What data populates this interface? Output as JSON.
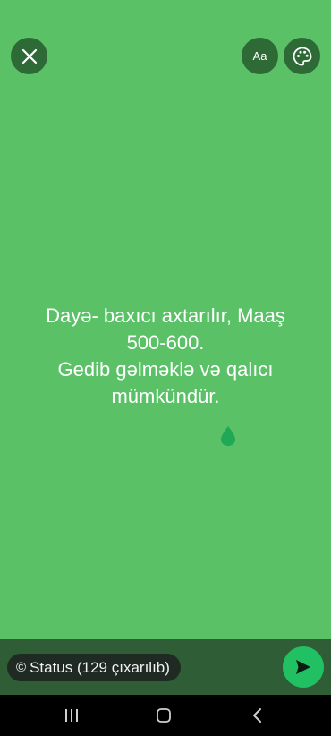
{
  "toolbar": {
    "close_icon": "close-icon",
    "font_button_label": "Aa",
    "palette_icon": "palette-icon"
  },
  "status": {
    "text": "Dayə- baxıcı axtarılır, Maaş\n500-600.\nGedib gəlməklə və qalıcı\nmümkündür."
  },
  "footer": {
    "audience_icon": "copyright-circle-icon",
    "audience_label": "Status (129 çıxarılıb)",
    "send_icon": "send-icon"
  },
  "nav": {
    "recents_icon": "recents-icon",
    "home_icon": "home-icon",
    "back_icon": "back-icon"
  },
  "colors": {
    "background": "#5ac167",
    "footer": "#2e5d36",
    "send_button": "#21c063",
    "text": "#ffffff"
  }
}
